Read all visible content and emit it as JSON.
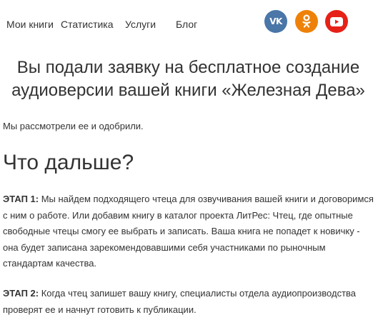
{
  "nav": {
    "items": [
      {
        "label": "Мои книги"
      },
      {
        "label": "Статистика"
      },
      {
        "label": "Услуги"
      },
      {
        "label": "Блог"
      }
    ]
  },
  "social": [
    {
      "name": "vk",
      "icon": "vk-icon",
      "color": "#4A76A8",
      "glyph": "VK"
    },
    {
      "name": "odnoklassniki",
      "icon": "odnoklassniki-icon",
      "color": "#EE8208"
    },
    {
      "name": "youtube",
      "icon": "youtube-icon",
      "color": "#E62117"
    }
  ],
  "main": {
    "headline": "Вы подали заявку на бесплатное создание аудиоверсии вашей книги «Железная Дева»",
    "approved_text": "Мы рассмотрели ее и одобрили.",
    "section_title": "Что дальше?",
    "stages": [
      {
        "label": "ЭТАП 1:",
        "text": " Мы найдем подходящего чтеца для озвучивания вашей книги и договоримся с ним о работе. Или добавим книгу в каталог проекта ЛитРес: Чтец, где опытные свободные чтецы смогу ее выбрать и записать. Ваша книга не попадет к новичку - она будет записана зарекомендовавшими себя участниками по рыночным стандартам качества."
      },
      {
        "label": "ЭТАП 2:",
        "text": " Когда чтец запишет вашу книгу, специалисты отдела аудиопроизводства проверят ее и начнут готовить к публикации."
      }
    ]
  }
}
